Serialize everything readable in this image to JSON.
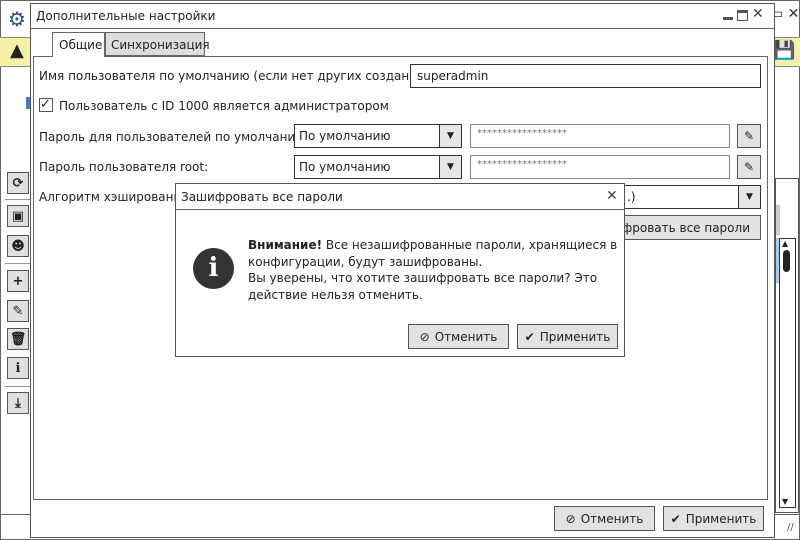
{
  "dialog": {
    "title": "Дополнительные настройки",
    "tabs": [
      {
        "label": "Общие",
        "active": true
      },
      {
        "label": "Синхронизация",
        "active": false
      }
    ],
    "default_user_label": "Имя пользователя по умолчанию (если нет других созданных):",
    "default_user_value": "superadmin",
    "admin_checkbox_label": "Пользователь с ID 1000 является администратором",
    "admin_checkbox_checked": true,
    "default_password_label": "Пароль для пользователей по умолчанию:",
    "default_password_mode": "По умолчанию",
    "default_password_mask": "******************",
    "root_password_label": "Пароль пользователя root:",
    "root_password_mode": "По умолчанию",
    "root_password_mask": "******************",
    "hash_label": "Алгоритм хэширования",
    "hash_value_visible": ".)",
    "encrypt_all_button": "ифровать все пароли",
    "cancel": "Отменить",
    "apply": "Применить"
  },
  "modal": {
    "title": "Зашифровать все пароли",
    "warning_bold": "Внимание!",
    "line1": " Все незашифрованные пароли, хранящиеся в",
    "line2": "конфигурации, будут зашифрованы.",
    "line3": "Вы уверены, что хотите зашифровать все пароли? Это",
    "line4": "действие нельзя отменить.",
    "cancel": "Отменить",
    "apply": "Применить",
    "icon": "info-icon"
  },
  "colors": {
    "warning_bar": "#f5f0a8",
    "selection": "#a8c8f0"
  }
}
